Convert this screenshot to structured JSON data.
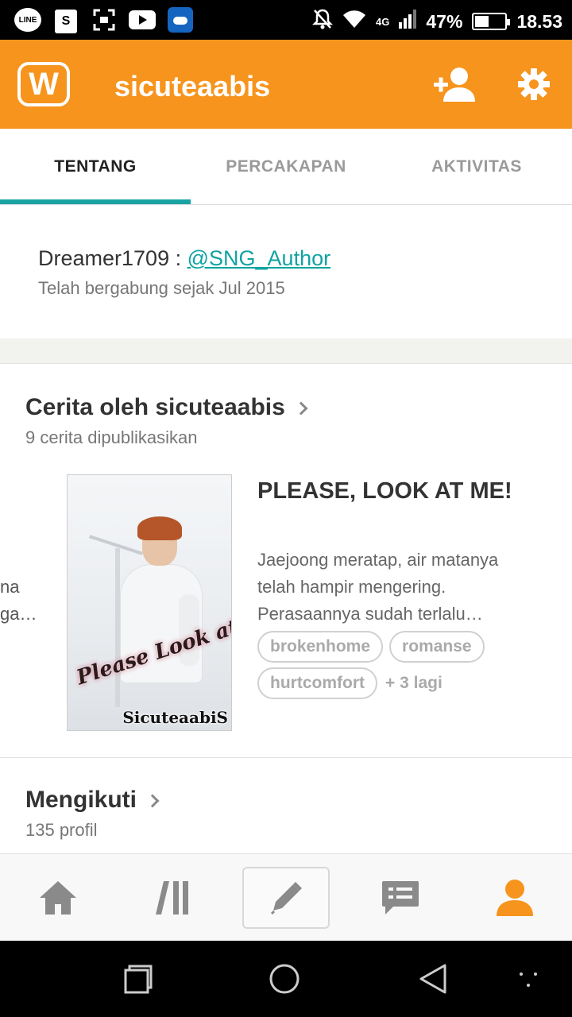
{
  "status_bar": {
    "left_icons": [
      "line-app-icon",
      "shopping-bag-icon",
      "scan-icon",
      "youtube-icon",
      "weather-icon"
    ],
    "line_label": "LINE",
    "shop_label": "S",
    "network": "4G",
    "battery": "47%",
    "battery_level": 0.47,
    "time": "18.53"
  },
  "app_bar": {
    "logo": "W",
    "title": "sicuteaabis",
    "accent_color": "#f7941d"
  },
  "tabs": [
    {
      "label": "TENTANG",
      "active": true
    },
    {
      "label": "PERCAKAPAN",
      "active": false
    },
    {
      "label": "AKTIVITAS",
      "active": false
    }
  ],
  "about": {
    "name": "Dreamer1709",
    "separator": " : ",
    "handle": "@SNG_Author",
    "joined": "Telah bergabung sejak Jul 2015"
  },
  "stories": {
    "title": "Cerita oleh sicuteaabis",
    "subtitle": "9 cerita dipublikasikan",
    "peek_line1": "na",
    "peek_line2": "ga…",
    "story": {
      "title": "PLEASE, LOOK AT ME!",
      "description": "Jaejoong meratap, air matanya telah hampir mengering. Perasaannya sudah terlalu…",
      "cover_title": "Please Look at Me",
      "cover_author": "SicuteaabiS",
      "tags": [
        "brokenhome",
        "romanse",
        "hurtcomfort"
      ],
      "more_tags": "+ 3 lagi"
    }
  },
  "following": {
    "title": "Mengikuti",
    "subtitle": "135 profil"
  },
  "bottom_nav": [
    "home-icon",
    "library-icon",
    "write-icon",
    "messages-icon",
    "profile-icon"
  ],
  "system_nav": [
    "recents-icon",
    "home-circle-icon",
    "back-icon",
    "menu-dots-icon"
  ]
}
